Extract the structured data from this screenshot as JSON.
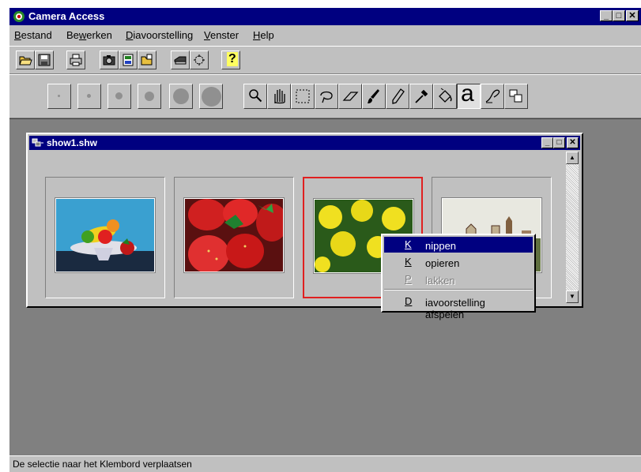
{
  "app": {
    "title": "Camera Access",
    "controls": {
      "minimize": "_",
      "maximize": "□",
      "close": "✕"
    }
  },
  "menubar": {
    "items": [
      {
        "pre": "",
        "key": "B",
        "post": "estand"
      },
      {
        "pre": "Be",
        "key": "w",
        "post": "erken"
      },
      {
        "pre": "",
        "key": "D",
        "post": "iavoorstelling"
      },
      {
        "pre": "",
        "key": "V",
        "post": "enster"
      },
      {
        "pre": "",
        "key": "H",
        "post": "elp"
      }
    ]
  },
  "toolbar": {
    "icons": [
      "open-icon",
      "save-icon",
      "print-icon",
      "camera-icon",
      "album-icon",
      "folder-icon",
      "scanner-icon",
      "effect-icon",
      "help-icon"
    ],
    "help_label": "?"
  },
  "drawing_toolbar": {
    "brush_sizes": [
      "brush-size-1",
      "brush-size-2",
      "brush-size-3",
      "brush-size-4",
      "brush-size-5",
      "brush-size-6"
    ],
    "tools": [
      "zoom-icon",
      "hand-icon",
      "rect-select-icon",
      "lasso-icon",
      "eraser-icon",
      "brush-icon",
      "pencil-icon",
      "dropper-icon",
      "fill-icon",
      "text-icon",
      "stamp-icon",
      "layers-icon"
    ],
    "text_tool_label": "a"
  },
  "child_window": {
    "title": "show1.shw",
    "controls": {
      "minimize": "_",
      "maximize": "□",
      "close": "✕"
    },
    "slides": [
      {
        "name": "fruit-bowl"
      },
      {
        "name": "strawberries"
      },
      {
        "name": "dandelions",
        "selected": true
      },
      {
        "name": "landscape"
      }
    ]
  },
  "context_menu": {
    "items": [
      {
        "pre": "",
        "key": "K",
        "post": "nippen",
        "highlighted": true,
        "disabled": false
      },
      {
        "pre": "",
        "key": "K",
        "post": "opieren",
        "highlighted": false,
        "disabled": false
      },
      {
        "pre": "",
        "key": "P",
        "post": "lakken",
        "highlighted": false,
        "disabled": true
      },
      {
        "pre": "",
        "key": "D",
        "post": "iavoorstelling afspelen",
        "highlighted": false,
        "disabled": false
      }
    ]
  },
  "status_bar": {
    "text": "De selectie naar het Klembord verplaatsen"
  }
}
